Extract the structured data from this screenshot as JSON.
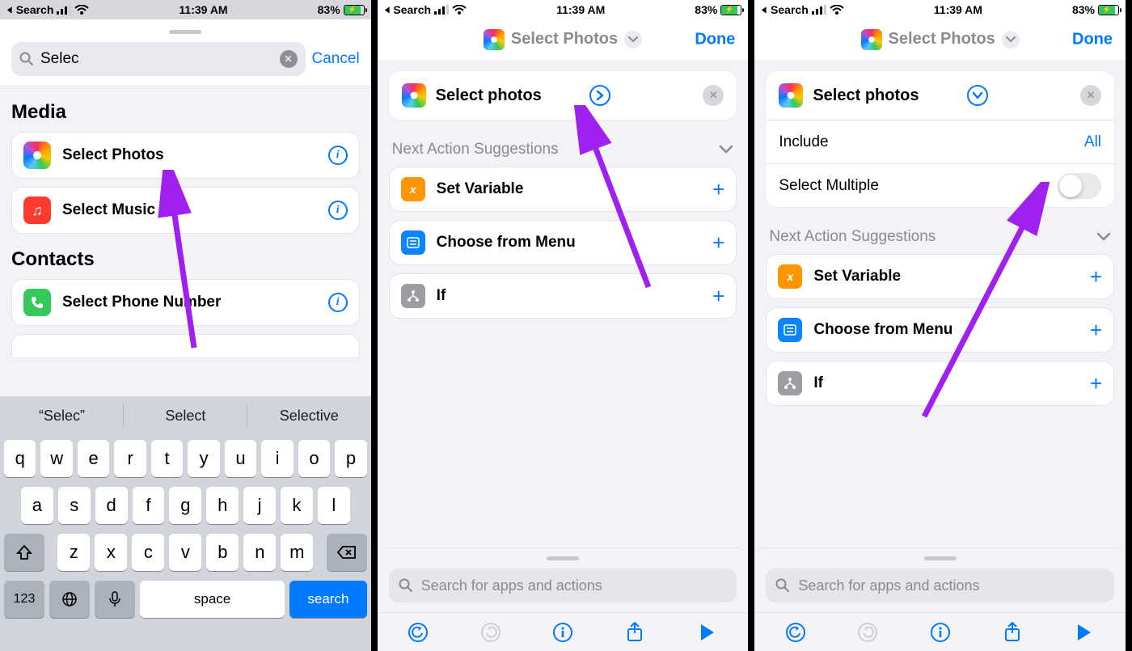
{
  "status": {
    "back": "Search",
    "time": "11:39 AM",
    "battery": "83%",
    "battery_fill": 83
  },
  "phone1": {
    "search_value": "Selec",
    "cancel": "Cancel",
    "sections": [
      {
        "title": "Media",
        "rows": [
          {
            "icon": "photos",
            "label": "Select Photos"
          },
          {
            "icon": "music",
            "label": "Select Music"
          }
        ]
      },
      {
        "title": "Contacts",
        "rows": [
          {
            "icon": "phone",
            "label": "Select Phone Number"
          }
        ]
      }
    ],
    "predictions": [
      "“Selec”",
      "Select",
      "Selective"
    ],
    "keyboard": {
      "rows": [
        [
          "q",
          "w",
          "e",
          "r",
          "t",
          "y",
          "u",
          "i",
          "o",
          "p"
        ],
        [
          "a",
          "s",
          "d",
          "f",
          "g",
          "h",
          "j",
          "k",
          "l"
        ],
        [
          "z",
          "x",
          "c",
          "v",
          "b",
          "n",
          "m"
        ]
      ],
      "numKey": "123",
      "space": "space",
      "action": "search"
    }
  },
  "phone2": {
    "header": "Select Photos",
    "done": "Done",
    "action_title": "Select photos",
    "suggestions_title": "Next Action Suggestions",
    "suggestions": [
      {
        "icon": "orange",
        "label": "Set Variable"
      },
      {
        "icon": "blue",
        "label": "Choose from Menu"
      },
      {
        "icon": "gray",
        "label": "If"
      }
    ],
    "search_placeholder": "Search for apps and actions"
  },
  "phone3": {
    "header": "Select Photos",
    "done": "Done",
    "action_title": "Select photos",
    "options": [
      {
        "key": "Include",
        "value": "All"
      },
      {
        "key": "Select Multiple",
        "toggle": false
      }
    ],
    "suggestions_title": "Next Action Suggestions",
    "suggestions": [
      {
        "icon": "orange",
        "label": "Set Variable"
      },
      {
        "icon": "blue",
        "label": "Choose from Menu"
      },
      {
        "icon": "gray",
        "label": "If"
      }
    ],
    "search_placeholder": "Search for apps and actions"
  }
}
